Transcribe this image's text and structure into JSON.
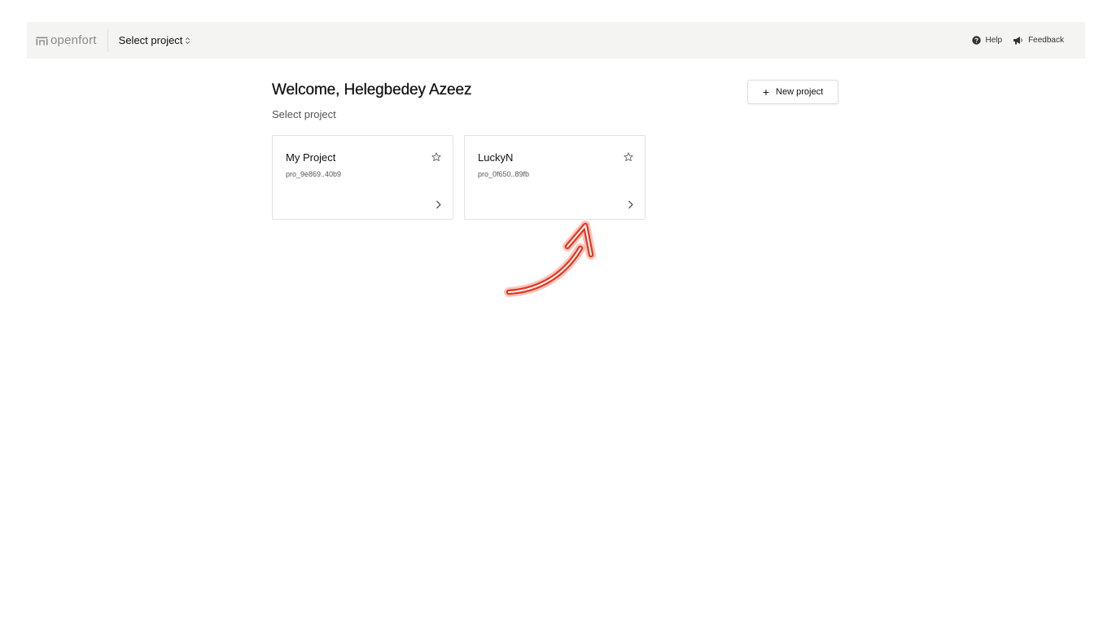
{
  "topbar": {
    "logo_text": "openfort",
    "logo_icon": "openfort-logo-icon",
    "project_select_label": "Select project",
    "project_select_icon": "chevron-up-down-icon",
    "help_label": "Help",
    "help_icon": "question-circle-icon",
    "feedback_label": "Feedback",
    "feedback_icon": "megaphone-icon"
  },
  "main": {
    "welcome_title": "Welcome, Helegbedey Azeez",
    "subtitle": "Select project",
    "new_project_label": "New project",
    "new_project_icon": "plus-icon"
  },
  "projects": [
    {
      "name": "My Project",
      "id": "pro_9e869..40b9",
      "favorite_icon": "star-outline-icon",
      "open_icon": "chevron-right-icon"
    },
    {
      "name": "LuckyN",
      "id": "pro_0f650..89fb",
      "favorite_icon": "star-outline-icon",
      "open_icon": "chevron-right-icon"
    }
  ],
  "annotation": {
    "arrow_color": "#e5361f",
    "arrow_icon": "curved-arrow-annotation"
  },
  "colors": {
    "topbar_bg": "#f4f4f3",
    "card_border": "#e2e2e2"
  }
}
